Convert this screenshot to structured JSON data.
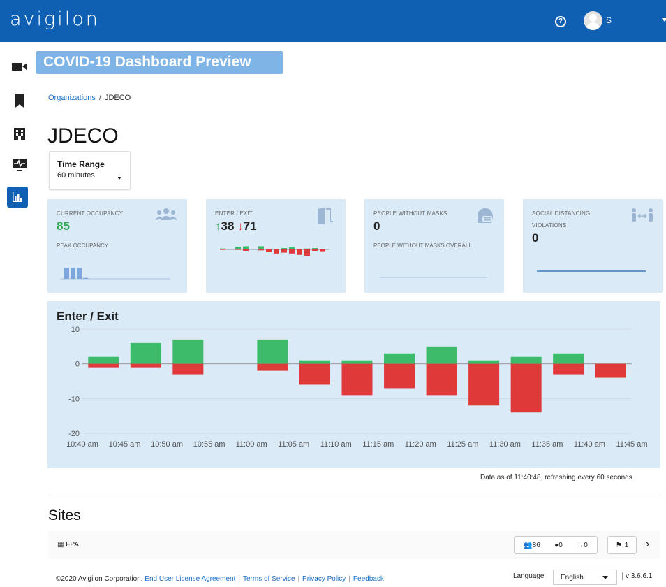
{
  "header": {
    "brand": "avigilon",
    "help_icon": "question-circle-icon",
    "user_initial": "S"
  },
  "sidebar": {
    "items": [
      {
        "name": "cameras",
        "icon": "video-camera-icon"
      },
      {
        "name": "bookmarks",
        "icon": "bookmark-icon"
      },
      {
        "name": "sites",
        "icon": "building-icon"
      },
      {
        "name": "monitoring",
        "icon": "monitor-pulse-icon"
      },
      {
        "name": "dashboard",
        "icon": "bar-chart-icon",
        "active": true
      }
    ]
  },
  "banner": {
    "text": "COVID-19 Dashboard Preview"
  },
  "breadcrumb": {
    "root": "Organizations",
    "separator": "/",
    "current": "JDECO"
  },
  "page": {
    "title": "JDECO"
  },
  "time_range": {
    "label": "Time Range",
    "value": "60 minutes"
  },
  "cards": {
    "occupancy": {
      "caption": "CURRENT OCCUPANCY",
      "value": "85",
      "value_color": "#2eaa57",
      "sub": "PEAK OCCUPANCY",
      "spark": [
        7,
        7,
        7,
        0.6
      ]
    },
    "enter_exit": {
      "caption": "ENTER / EXIT",
      "enter": "38",
      "exit": "71",
      "spark": [
        [
          2,
          1
        ],
        [
          0,
          0
        ],
        [
          6,
          1
        ],
        [
          7,
          3
        ],
        [
          0,
          0
        ],
        [
          7,
          2
        ],
        [
          1,
          6
        ],
        [
          1,
          9
        ],
        [
          3,
          7
        ],
        [
          5,
          9
        ],
        [
          1,
          12
        ],
        [
          2,
          14
        ],
        [
          3,
          3
        ],
        [
          0,
          4
        ]
      ]
    },
    "masks": {
      "caption": "PEOPLE WITHOUT MASKS",
      "value": "0",
      "sub": "PEOPLE WITHOUT MASKS OVERALL"
    },
    "distancing": {
      "caption_1": "SOCIAL DISTANCING",
      "caption_2": "VIOLATIONS",
      "value": "0"
    }
  },
  "enter_exit_panel": {
    "title": "Enter / Exit"
  },
  "chart_data": {
    "type": "bar",
    "title": "Enter / Exit",
    "ylim": [
      -20,
      10
    ],
    "yticks": [
      10,
      0,
      -10,
      -20
    ],
    "x_tick_labels": [
      "10:40 am",
      "10:45 am",
      "10:50 am",
      "10:55 am",
      "11:00 am",
      "11:05 am",
      "11:10 am",
      "11:15 am",
      "11:20 am",
      "11:25 am",
      "11:30 am",
      "11:35 am",
      "11:40 am",
      "11:45 am"
    ],
    "series": [
      {
        "color": "#3dba6a",
        "values": [
          2,
          6,
          7,
          0,
          7,
          1,
          1,
          3,
          5,
          1,
          2,
          3,
          0
        ]
      },
      {
        "color": "#e0393a",
        "values": [
          -1,
          -1,
          -3,
          0,
          -2,
          -6,
          -9,
          -7,
          -9,
          -12,
          -14,
          -3,
          -4
        ]
      }
    ],
    "grid": true
  },
  "status": {
    "as_of": "Data as of 11:40:48, refreshing every 60 seconds"
  },
  "sites": {
    "title": "Sites",
    "rows": [
      {
        "name": "FPA",
        "occupancy": "86",
        "masks": "0",
        "distancing": "0",
        "flags": "1"
      }
    ]
  },
  "footer": {
    "copyright": "©2020 Avigilon Corporation.",
    "links": [
      "End User License Agreement",
      "Terms of Service",
      "Privacy Policy",
      "Feedback"
    ],
    "language_label": "Language",
    "language_value": "English",
    "version": "v 3.6.6.1"
  }
}
